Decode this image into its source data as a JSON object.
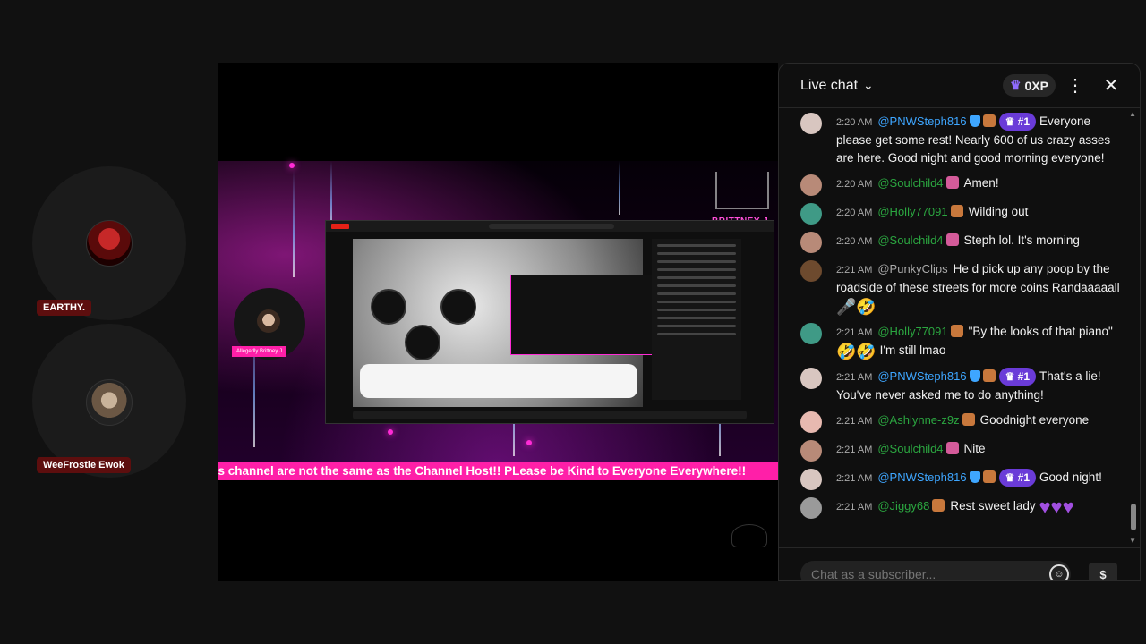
{
  "participants": [
    {
      "name": "EARTHY."
    },
    {
      "name": "WeeFrostie Ewok"
    }
  ],
  "stage": {
    "ticker_text": "st on this channel are not the same as the Channel Host!! PLease be Kind to Everyone Everywhere!!",
    "host_tag": "Allegedly Brittney J",
    "brand_name": "BRITTNEY J"
  },
  "chat": {
    "title": "Live chat",
    "xp": "0XP",
    "input_placeholder": "Chat as a subscriber...",
    "messages": [
      {
        "time": "2:20 AM",
        "author": "@PNWSteph816",
        "rank": "#1",
        "text": "Everyone please get some rest! Nearly 600 of us crazy asses are here. Good night and good morning everyone!"
      },
      {
        "time": "2:20 AM",
        "author": "@Soulchild4",
        "text": "Amen!"
      },
      {
        "time": "2:20 AM",
        "author": "@Holly77091",
        "text": "Wilding out"
      },
      {
        "time": "2:20 AM",
        "author": "@Soulchild4",
        "text": "Steph lol. It's morning"
      },
      {
        "time": "2:21 AM",
        "author": "@PunkyClips",
        "text": "He d pick up any poop by the roadside of these streets for more coins Randaaaaall"
      },
      {
        "time": "2:21 AM",
        "author": "@Holly77091",
        "text": "\"By the looks of that piano\"",
        "text2": "I'm still lmao"
      },
      {
        "time": "2:21 AM",
        "author": "@PNWSteph816",
        "rank": "#1",
        "text": "That's a lie! You've never asked me to do anything!"
      },
      {
        "time": "2:21 AM",
        "author": "@Ashlynne-z9z",
        "text": "Goodnight everyone"
      },
      {
        "time": "2:21 AM",
        "author": "@Soulchild4",
        "text": "Nite"
      },
      {
        "time": "2:21 AM",
        "author": "@PNWSteph816",
        "rank": "#1",
        "text": "Good night!"
      },
      {
        "time": "2:21 AM",
        "author": "@Jiggy68",
        "text": "Rest sweet lady"
      }
    ]
  },
  "icons": {
    "menu": "more-vert-icon",
    "close": "close-icon",
    "emoji": "smiley-icon",
    "super_chat": "dollar-icon"
  }
}
